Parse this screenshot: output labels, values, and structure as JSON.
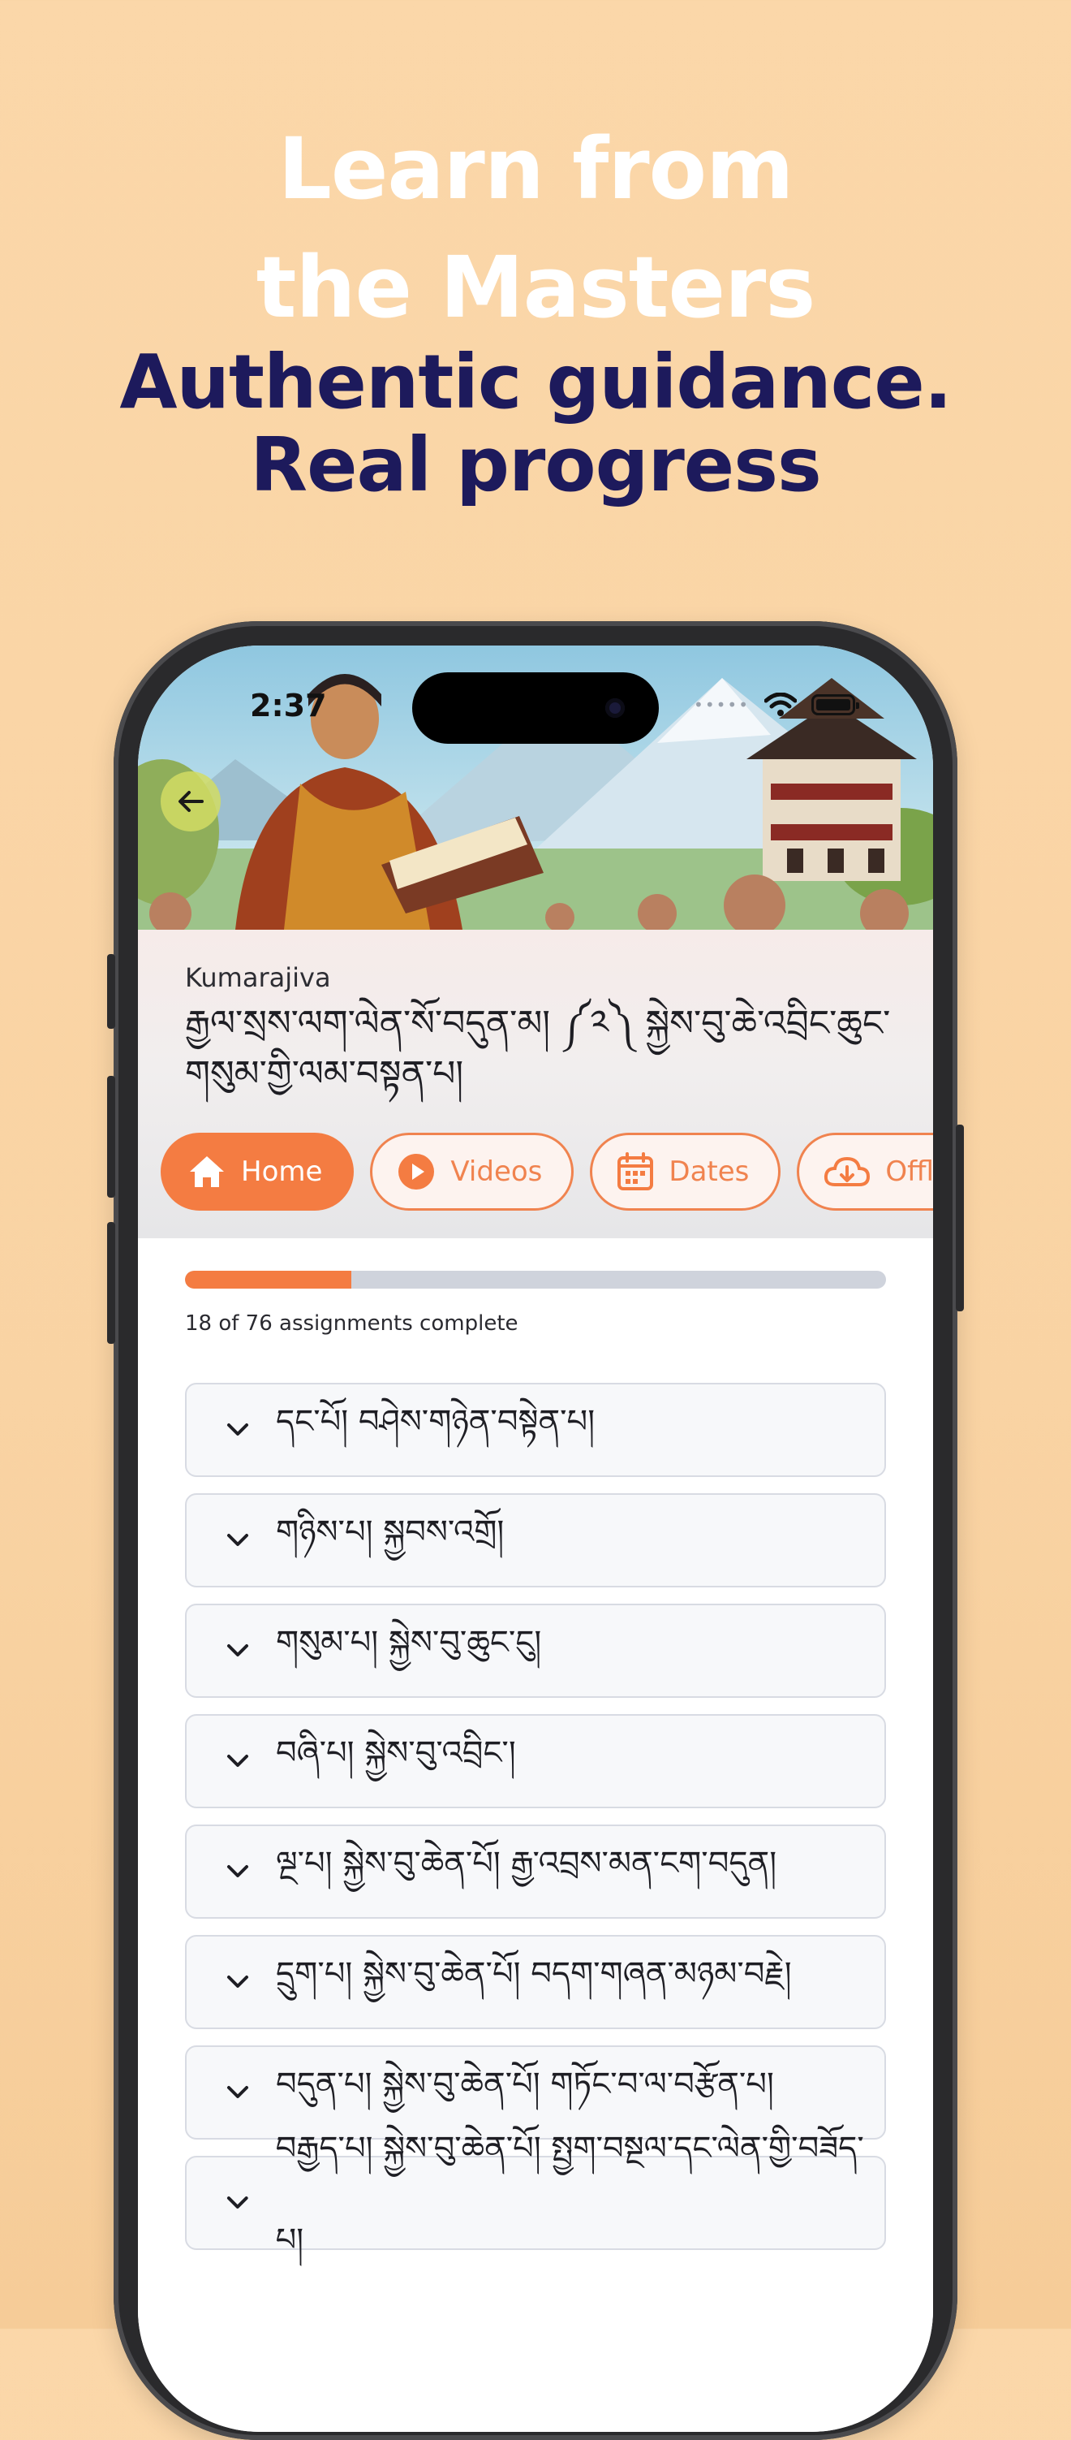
{
  "marketing": {
    "headline": "Learn from the Masters",
    "subheadline": "Authentic guidance. Real progress"
  },
  "status_bar": {
    "time": "2:37"
  },
  "header": {
    "author": "Kumarajiva",
    "title": "རྒྱལ་སྲས་ལག་ལེན་སོ་བདུན་མ། ༼༢༽ སྐྱེས་བུ་ཆེ་འབྲིང་ཆུང་གསུམ་གྱི་ལམ་བསྟན་པ།"
  },
  "tabs": [
    {
      "label": "Home",
      "icon": "home-icon",
      "active": true
    },
    {
      "label": "Videos",
      "icon": "play-icon",
      "active": false
    },
    {
      "label": "Dates",
      "icon": "calendar-icon",
      "active": false
    },
    {
      "label": "Offline",
      "icon": "cloud-download-icon",
      "active": false
    }
  ],
  "progress": {
    "completed": 18,
    "total": 76,
    "text": "18 of 76 assignments complete"
  },
  "sections": [
    "དང་པོ། བཤེས་གཉེན་བསྟེན་པ།",
    "གཉིས་པ། སྐྱབས་འགྲོ།",
    "གསུམ་པ། སྐྱེས་བུ་ཆུང་ངུ།",
    "བཞི་པ། སྐྱེས་བུ་འབྲིང་།",
    "ལྔ་པ། སྐྱེས་བུ་ཆེན་པོ། རྒྱ་འབྲས་མན་ངག་བདུན།",
    "དྲུག་པ། སྐྱེས་བུ་ཆེན་པོ། བདག་གཞན་མཉམ་བརྗེ།",
    "བདུན་པ། སྐྱེས་བུ་ཆེན་པོ། གཏོང་བ་ལ་བརྩོན་པ།",
    "བརྒྱད་པ། སྐྱེས་བུ་ཆེན་པོ། སྤྱག་བསྔལ་དང་ལེན་གྱི་བཟོད་པ།"
  ],
  "colors": {
    "background": "#fbd7a9",
    "accent": "#f47c42",
    "headline_white": "#ffffff",
    "headline_navy": "#1d1a5c"
  }
}
